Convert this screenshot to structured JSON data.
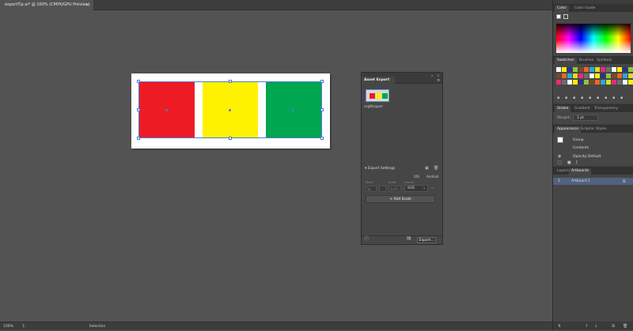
{
  "document": {
    "tab_title": "exportTip.ai* @ 100% (CMYK/GPU Preview)",
    "close_glyph": "×"
  },
  "artwork": {
    "squares": [
      {
        "name": "red-square",
        "color": "#ed1c24"
      },
      {
        "name": "yellow-square",
        "color": "#fff200"
      },
      {
        "name": "green-square",
        "color": "#00a650"
      }
    ]
  },
  "status_bar": {
    "zoom": "100%",
    "artboard_number": "1",
    "tool": "Selection"
  },
  "asset_export": {
    "tab_label": "Asset Export",
    "asset_label": "svgWrapper",
    "export_settings_label": "Export Settings",
    "ios_label": "iOS",
    "android_label": "Android",
    "scale_header": "Scale",
    "suffix_header": "Suffix",
    "format_header": "Format",
    "scale_value": "1x",
    "suffix_placeholder": "Suffix",
    "format_value": "SVG",
    "add_scale_label": "Add Scale",
    "export_button_label": "Export..."
  },
  "color_panel": {
    "tabs": [
      "Color",
      "Color Guide"
    ]
  },
  "swatches_panel": {
    "tabs": [
      "Swatches",
      "Brushes",
      "Symbols"
    ]
  },
  "stroke_panel": {
    "tabs": [
      "Stroke",
      "Gradient",
      "Transparency"
    ],
    "weight_label": "Weight:",
    "weight_value": "1 pt"
  },
  "appearance_panel": {
    "tabs": [
      "Appearance",
      "Graphic Styles"
    ],
    "group_label": "Group",
    "contents_label": "Contents",
    "opacity_label": "Opacity:",
    "opacity_value": "Default"
  },
  "layers_panel": {
    "tabs": [
      "Layers",
      "Artboards"
    ],
    "artboard_index": "1",
    "artboard_name": "Artboard 1"
  },
  "colors": {
    "selection": "#4d7bd6",
    "panel_bg": "#464646",
    "canvas_bg": "#535353"
  }
}
